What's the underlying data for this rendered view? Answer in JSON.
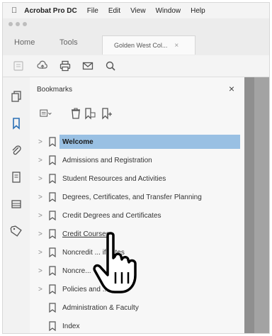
{
  "menubar": {
    "app": "Acrobat Pro DC",
    "items": [
      "File",
      "Edit",
      "View",
      "Window",
      "Help"
    ]
  },
  "tabs": {
    "home": "Home",
    "tools": "Tools",
    "document": "Golden West Col...",
    "document_close": "×"
  },
  "toolbar": {
    "icons": [
      "create-pdf-icon",
      "upload-icon",
      "print-icon",
      "email-icon",
      "search-icon"
    ]
  },
  "left_rail": {
    "icons": [
      "pages-icon",
      "bookmark-icon",
      "attachments-icon",
      "copy-icon",
      "layers-icon",
      "tag-icon"
    ]
  },
  "bookmarks_panel": {
    "title": "Bookmarks",
    "close": "×",
    "items": [
      {
        "label": "Welcome",
        "expandable": true,
        "selected": true
      },
      {
        "label": "Admissions and Registration",
        "expandable": true
      },
      {
        "label": "Student Resources and Activities",
        "expandable": true
      },
      {
        "label": "Degrees, Certificates, and Transfer Planning",
        "expandable": true
      },
      {
        "label": "Credit Degrees and Certificates",
        "expandable": true
      },
      {
        "label": "Credit Courses",
        "expandable": true,
        "hovered": true
      },
      {
        "label": "Noncredit ... ificates",
        "expandable": true
      },
      {
        "label": "Noncre...",
        "expandable": true
      },
      {
        "label": "Policies and ... ards",
        "expandable": true
      },
      {
        "label": "Administration & Faculty",
        "expandable": false
      },
      {
        "label": "Index",
        "expandable": false
      }
    ]
  },
  "colors": {
    "selection": "#99c0e3",
    "panel_bg": "#f7f7f7",
    "doc_bg": "#8f8f8f"
  }
}
